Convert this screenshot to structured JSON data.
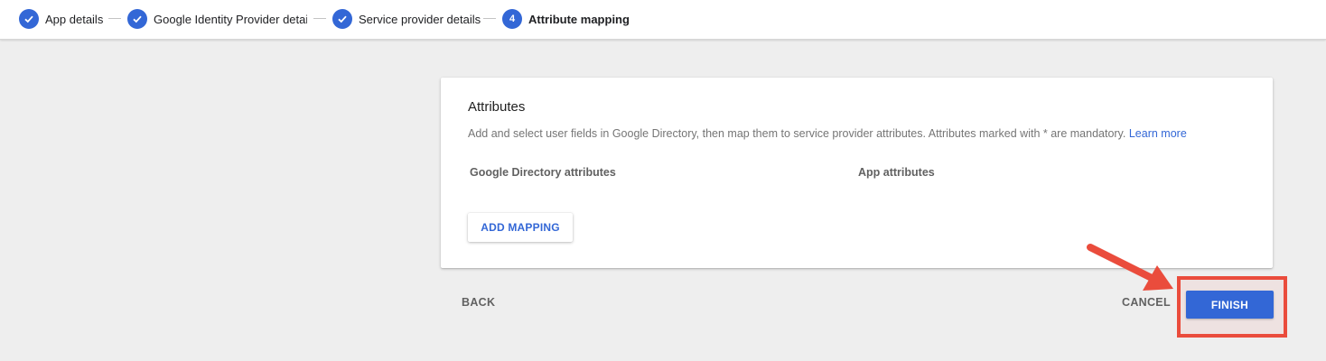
{
  "stepper": {
    "steps": [
      {
        "number": "1",
        "label": "App details",
        "status": "completed"
      },
      {
        "number": "2",
        "label": "Google Identity Provider details",
        "status": "completed"
      },
      {
        "number": "3",
        "label": "Service provider details",
        "status": "completed"
      },
      {
        "number": "4",
        "label": "Attribute mapping",
        "status": "current"
      }
    ],
    "completed_icon": "check-icon"
  },
  "card": {
    "title": "Attributes",
    "description": "Add and select user fields in Google Directory, then map them to service provider attributes. Attributes marked with * are mandatory.",
    "learn_more": "Learn more",
    "columns": [
      "Google Directory attributes",
      "App attributes"
    ],
    "add_mapping_label": "ADD MAPPING"
  },
  "footer": {
    "back_label": "BACK",
    "cancel_label": "CANCEL",
    "finish_label": "FINISH"
  },
  "colors": {
    "accent": "#3367d6",
    "annotation": "#ea4c3c",
    "background": "#eeeeee"
  }
}
